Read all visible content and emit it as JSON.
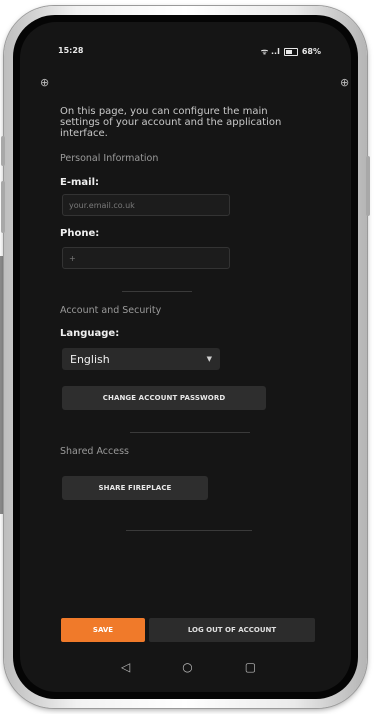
{
  "status": {
    "time": "15:28",
    "signal_icon": "wifi-signal-icon",
    "battery": "68%"
  },
  "intro_text": "On this page, you can configure the main settings of your account and the application interface.",
  "personal": {
    "section_title": "Personal Information",
    "email_label": "E-mail:",
    "email_placeholder": "your.email.co.uk",
    "phone_label": "Phone:",
    "phone_value": "+"
  },
  "security": {
    "section_title": "Account and Security",
    "language_label": "Language:",
    "language_selected": "English",
    "change_password_label": "CHANGE ACCOUNT PASSWORD"
  },
  "shared": {
    "section_title": "Shared Access",
    "share_button_label": "SHARE FIREPLACE"
  },
  "actions": {
    "save_label": "SAVE",
    "logout_label": "LOG OUT OF ACCOUNT"
  },
  "nav": {
    "back": "◁",
    "home": "○",
    "recents": "▢"
  },
  "colors": {
    "accent": "#f07a2a",
    "background": "#151515"
  }
}
